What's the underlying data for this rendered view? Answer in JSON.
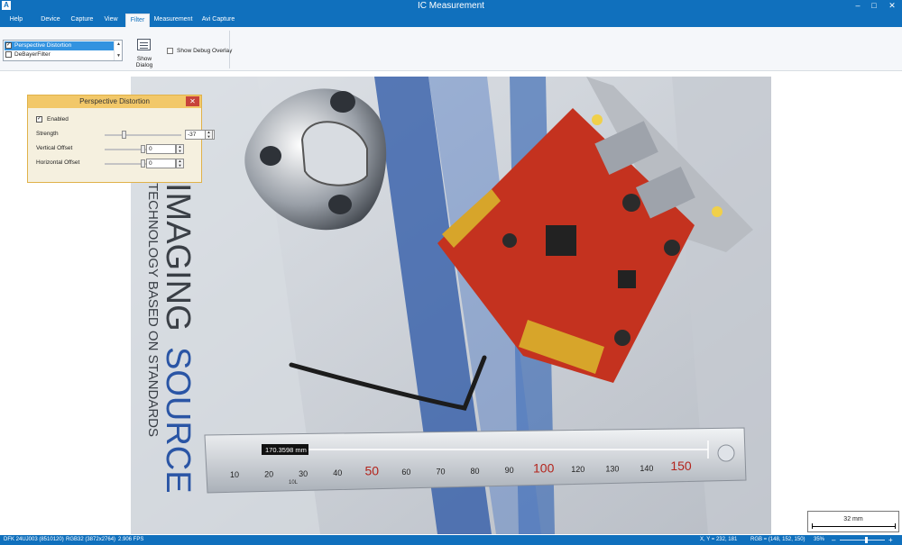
{
  "window": {
    "title": "IC Measurement",
    "controls": {
      "minimize": "–",
      "maximize": "□",
      "close": "✕"
    }
  },
  "tabs": [
    {
      "label": "Help",
      "active": false
    },
    {
      "label": "Device",
      "active": false
    },
    {
      "label": "Capture",
      "active": false
    },
    {
      "label": "View",
      "active": false
    },
    {
      "label": "Filter",
      "active": true
    },
    {
      "label": "Measurement",
      "active": false
    },
    {
      "label": "Avi Capture",
      "active": false
    }
  ],
  "ribbon": {
    "filters": [
      {
        "label": "Perspective Distortion",
        "checked": true,
        "selected": true
      },
      {
        "label": "DeBayerFilter",
        "checked": false,
        "selected": false
      }
    ],
    "show_dialog_label": "Show Dialog",
    "show_debug_overlay_label": "Show Debug Overlay",
    "show_debug_overlay_checked": false
  },
  "dialog": {
    "title": "Perspective Distortion",
    "enabled_label": "Enabled",
    "enabled": true,
    "params": [
      {
        "label": "Strength",
        "value": "-37",
        "level": 0.26
      },
      {
        "label": "Vertical Offset",
        "value": "0",
        "level": 0.5
      },
      {
        "label": "Horizontal Offset",
        "value": "0",
        "level": 0.5
      }
    ]
  },
  "image": {
    "measurement_label": "170.3598 mm",
    "ruler_labels": [
      "10",
      "20",
      "30",
      "40",
      "50",
      "60",
      "70",
      "80",
      "90",
      "100",
      "120",
      "130",
      "140",
      "150"
    ],
    "ruler_small_text": "10L",
    "box_text": [
      "IMAGING",
      "SOURCE",
      "TECHNOLOGY BASED ON STANDARDS"
    ]
  },
  "scale_overlay": {
    "label": "32 mm"
  },
  "status": {
    "device": "DFK 24UJ003 (8510120)",
    "format": "RGB32 (3872x2764)",
    "fps": "2.906 FPS",
    "xy": "X, Y = 232, 181",
    "rgb": "RGB = (148, 152, 150)",
    "zoom": "35%",
    "zoom_level": 0.55
  },
  "colors": {
    "accent": "#1070bd",
    "dialog_header": "#f2c869",
    "pcb_red": "#c4321f",
    "stripe_blue": "#2a55a5"
  }
}
